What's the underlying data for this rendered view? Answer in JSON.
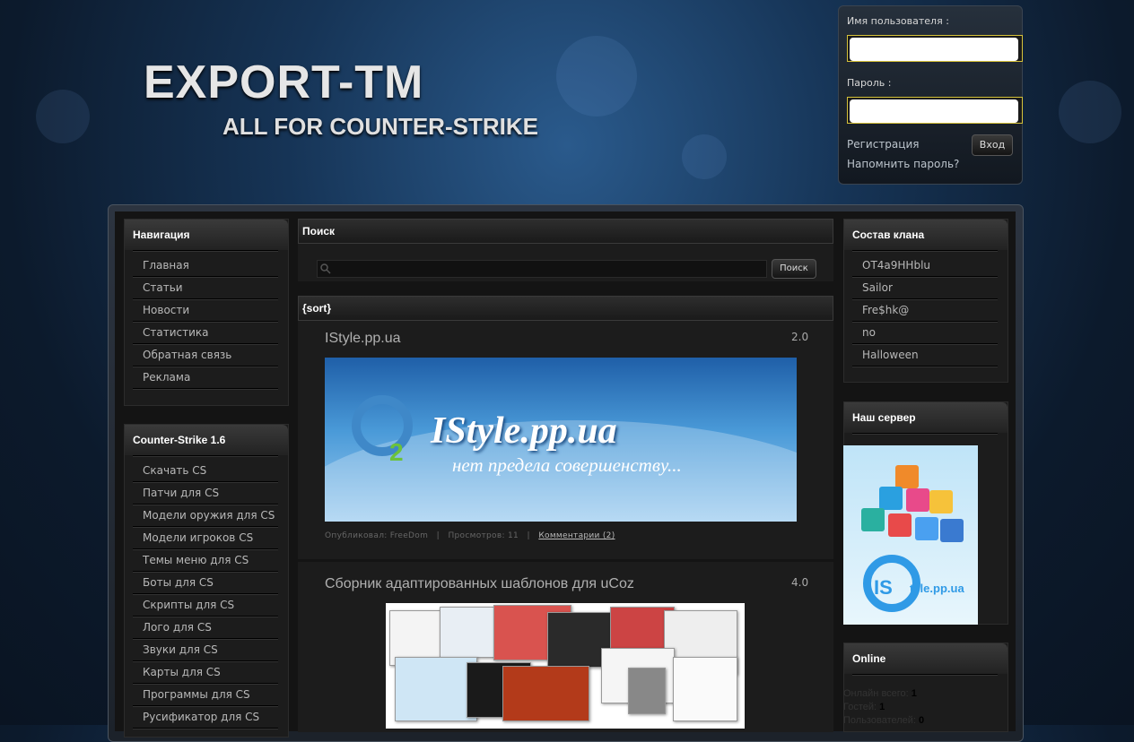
{
  "header": {
    "logo_title": "EXPORT-TM",
    "logo_subtitle": "ALL FOR COUNTER-STRIKE"
  },
  "login": {
    "username_label": "Имя пользователя :",
    "password_label": "Пароль :",
    "register_link": "Регистрация",
    "remind_link": "Напомнить пароль?",
    "submit_label": "Вход"
  },
  "navigation": {
    "title": "Навигация",
    "items": [
      "Главная",
      "Статьи",
      "Новости",
      "Статистика",
      "Обратная связь",
      "Реклама"
    ]
  },
  "cs_menu": {
    "title": "Counter-Strike 1.6",
    "items": [
      "Скачать CS",
      "Патчи для CS",
      "Модели оружия для CS",
      "Модели игроков CS",
      "Темы меню для CS",
      "Боты для CS",
      "Скрипты для CS",
      "Лого для CS",
      "Звуки для CS",
      "Карты для CS",
      "Программы для CS",
      "Русификатор для CS"
    ]
  },
  "search": {
    "title": "Поиск",
    "button_label": "Поиск",
    "value": ""
  },
  "sort": {
    "title": "{sort}"
  },
  "posts": [
    {
      "title": "IStyle.pp.ua",
      "rating": "2.0",
      "banner_brand": "IStyle.pp.ua",
      "banner_tagline": "нет предела совершенству...",
      "banner_logo": "O",
      "banner_logo_sub": "2",
      "meta_author": "Опубликовал: FreeDom",
      "meta_sep": "|",
      "meta_views": "Просмотров: 11",
      "meta_comments": "Комментарии (2)"
    },
    {
      "title": "Сборник адаптированных шаблонов для uCoz",
      "rating": "4.0"
    }
  ],
  "clan": {
    "title": "Состав клана",
    "members": [
      "OT4a9HHblu",
      "Sailor",
      "Fre$hk@",
      "no",
      "Halloween"
    ]
  },
  "server": {
    "title": "Наш сервер",
    "logo_text": "IS",
    "logo_text2": "tyle.pp.ua"
  },
  "online": {
    "title": "Online",
    "total_label": "Онлайн всего:",
    "total_value": "1",
    "guests_label": "Гостей:",
    "guests_value": "1",
    "users_label": "Пользователей:",
    "users_value": "0"
  },
  "colors": {
    "accent_border": "#d6c23a",
    "bg_dark": "#141414",
    "banner_blue": "#2f9ae6"
  }
}
